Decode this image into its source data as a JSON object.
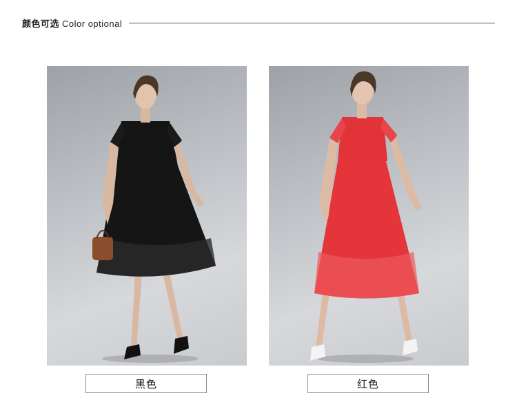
{
  "header": {
    "title_cn": "颜色可选",
    "title_en": "Color optional"
  },
  "variants": [
    {
      "label": "黑色",
      "color": "#111111"
    },
    {
      "label": "红色",
      "color": "#e0373c"
    }
  ]
}
